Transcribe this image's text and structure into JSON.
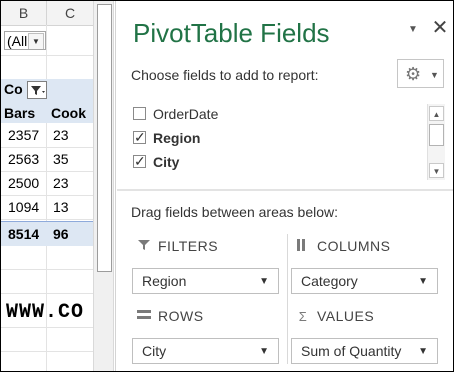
{
  "sheet": {
    "col_headers": [
      "B",
      "C"
    ],
    "filter_value": "(All",
    "pivot_col_label": "Co",
    "headers": [
      "Bars",
      "Cook"
    ],
    "rows": [
      [
        "2357",
        "23"
      ],
      [
        "2563",
        "35"
      ],
      [
        "2500",
        "23"
      ],
      [
        "1094",
        "13"
      ]
    ],
    "totals": [
      "8514",
      "96"
    ],
    "website": "WWW.CO"
  },
  "pane": {
    "title": "PivotTable Fields",
    "choose_label": "Choose fields to add to report:",
    "fields": [
      {
        "label": "OrderDate",
        "checked": false
      },
      {
        "label": "Region",
        "checked": true
      },
      {
        "label": "City",
        "checked": true
      }
    ],
    "drag_label": "Drag fields between areas below:",
    "areas": {
      "filters": {
        "label": "FILTERS",
        "value": "Region"
      },
      "columns": {
        "label": "COLUMNS",
        "value": "Category"
      },
      "rows": {
        "label": "ROWS",
        "value": "City"
      },
      "values": {
        "label": "VALUES",
        "value": "Sum of Quantity"
      }
    }
  }
}
